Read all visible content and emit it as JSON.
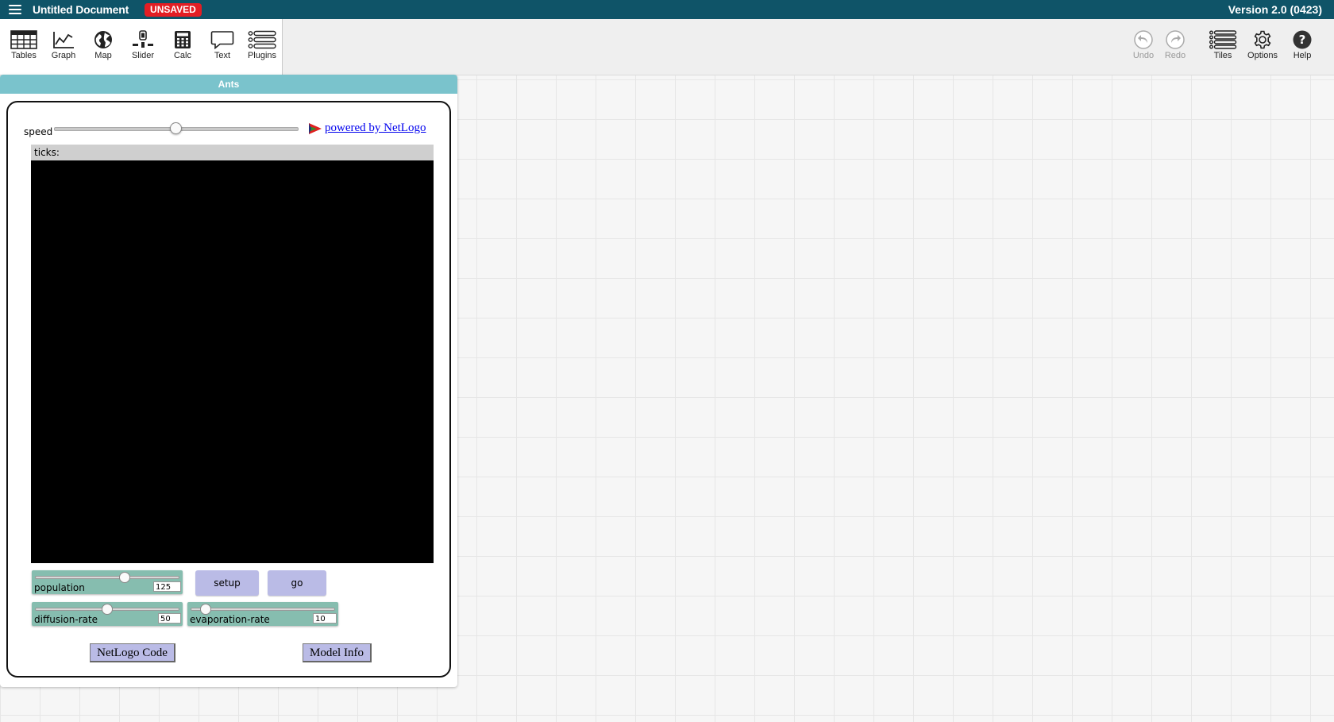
{
  "header": {
    "doc_title": "Untitled Document",
    "unsaved_badge": "UNSAVED",
    "version": "Version 2.0 (0423)",
    "bar_color": "#0f5468",
    "badge_color": "#e31e24"
  },
  "toolbar": {
    "left": [
      {
        "label": "Tables",
        "icon": "table-icon"
      },
      {
        "label": "Graph",
        "icon": "graph-icon"
      },
      {
        "label": "Map",
        "icon": "globe-icon"
      },
      {
        "label": "Slider",
        "icon": "slider-icon"
      },
      {
        "label": "Calc",
        "icon": "calculator-icon"
      },
      {
        "label": "Text",
        "icon": "speech-bubble-icon"
      },
      {
        "label": "Plugins",
        "icon": "plugins-icon"
      }
    ],
    "right": [
      {
        "label": "Undo",
        "icon": "undo-icon",
        "disabled": true
      },
      {
        "label": "Redo",
        "icon": "redo-icon",
        "disabled": true
      },
      {
        "label": "Tiles",
        "icon": "tiles-icon",
        "disabled": false
      },
      {
        "label": "Options",
        "icon": "gear-icon",
        "disabled": false
      },
      {
        "label": "Help",
        "icon": "help-icon",
        "disabled": false
      }
    ]
  },
  "tile": {
    "title": "Ants",
    "title_color": "#7ac3cc"
  },
  "netlogo": {
    "speed_label": "speed",
    "speed_level": 0.5,
    "powered_by": "powered by NetLogo",
    "ticks_label": "ticks:",
    "sliders": [
      {
        "name": "population",
        "value": "125",
        "level": 0.62
      },
      {
        "name": "diffusion-rate",
        "value": "50",
        "level": 0.5
      },
      {
        "name": "evaporation-rate",
        "value": "10",
        "level": 0.1
      }
    ],
    "buttons": {
      "setup": "setup",
      "go": "go"
    },
    "code_button": "NetLogo Code",
    "info_button": "Model Info",
    "widget_color": "#86bdaf",
    "button_color": "#babbe6"
  }
}
